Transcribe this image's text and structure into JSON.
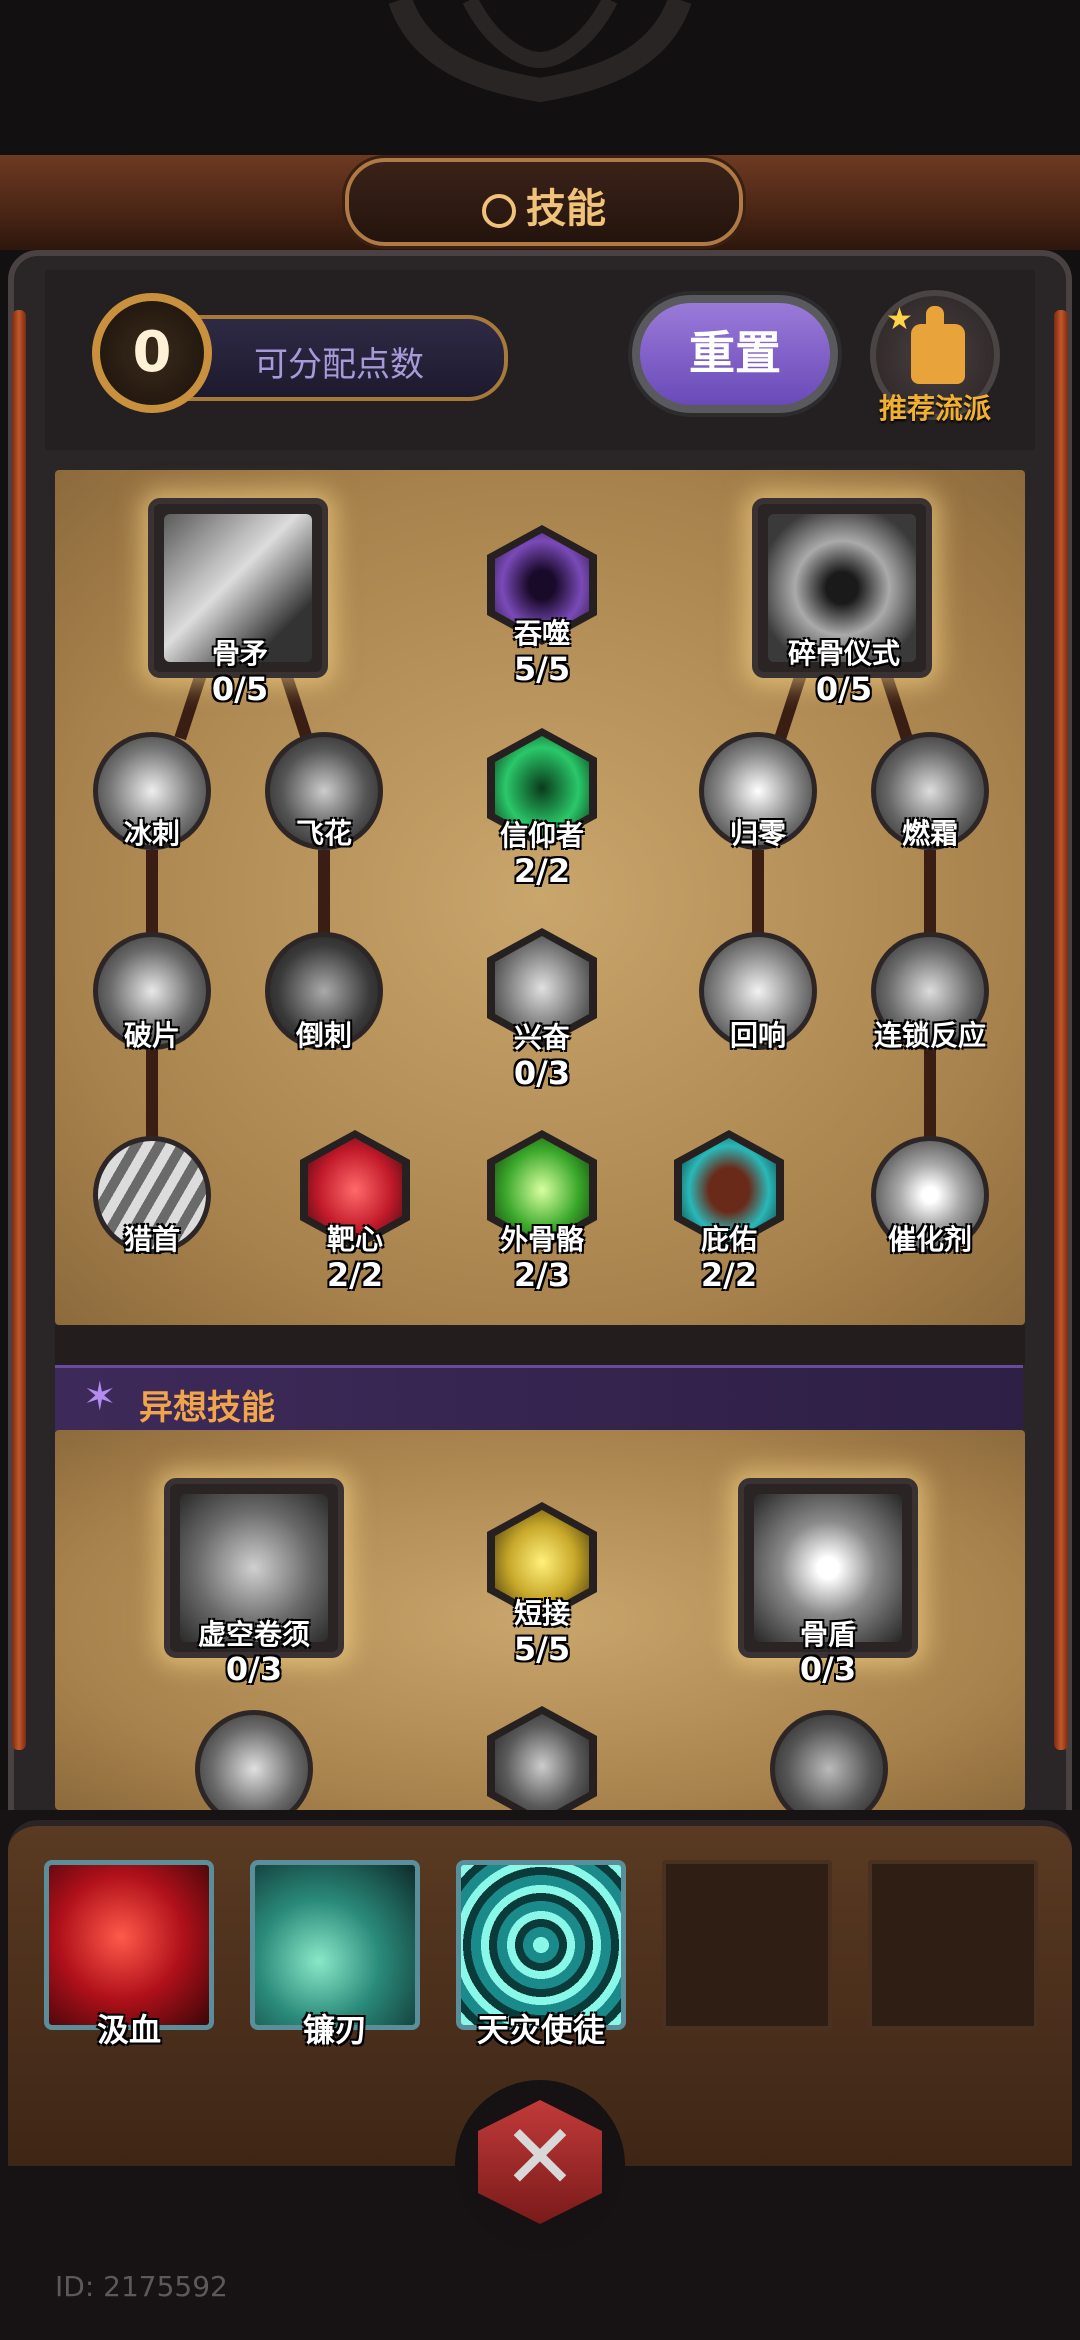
{
  "header": {
    "title": "技能",
    "title_icon": "skill-wheel-icon"
  },
  "points": {
    "value": "0",
    "label": "可分配点数"
  },
  "reset_button": {
    "label": "重置"
  },
  "recommend": {
    "label": "推荐流派",
    "icon": "thumbs-up-icon"
  },
  "skill_tree": [
    {
      "name": "骨矛",
      "count": "0/5",
      "shape": "square"
    },
    {
      "name": "吞噬",
      "count": "5/5",
      "shape": "hex"
    },
    {
      "name": "碎骨仪式",
      "count": "0/5",
      "shape": "square"
    },
    {
      "name": "冰刺",
      "count": "",
      "shape": "circle"
    },
    {
      "name": "飞花",
      "count": "",
      "shape": "circle"
    },
    {
      "name": "信仰者",
      "count": "2/2",
      "shape": "hex"
    },
    {
      "name": "归零",
      "count": "",
      "shape": "circle"
    },
    {
      "name": "燃霜",
      "count": "",
      "shape": "circle"
    },
    {
      "name": "破片",
      "count": "",
      "shape": "circle"
    },
    {
      "name": "倒刺",
      "count": "",
      "shape": "circle"
    },
    {
      "name": "兴奋",
      "count": "0/3",
      "shape": "hex"
    },
    {
      "name": "回响",
      "count": "",
      "shape": "circle"
    },
    {
      "name": "连锁反应",
      "count": "",
      "shape": "circle"
    },
    {
      "name": "猎首",
      "count": "",
      "shape": "circle"
    },
    {
      "name": "靶心",
      "count": "2/2",
      "shape": "hex"
    },
    {
      "name": "外骨骼",
      "count": "2/3",
      "shape": "hex"
    },
    {
      "name": "庇佑",
      "count": "2/2",
      "shape": "hex"
    },
    {
      "name": "催化剂",
      "count": "",
      "shape": "circle"
    }
  ],
  "mystery": {
    "title": "异想技能",
    "skills": [
      {
        "name": "虚空卷须",
        "count": "0/3"
      },
      {
        "name": "短接",
        "count": "5/5"
      },
      {
        "name": "骨盾",
        "count": "0/3"
      }
    ]
  },
  "equipped": [
    {
      "name": "汲血"
    },
    {
      "name": "镰刃"
    },
    {
      "name": "天灾使徒"
    }
  ],
  "user_id": "ID: 2175592",
  "colors": {
    "accent_gold": "#f0c27a",
    "reset_purple": "#8a6ac8",
    "recommend_orange": "#f2b030",
    "mystery_purple": "#3e2a5a"
  }
}
